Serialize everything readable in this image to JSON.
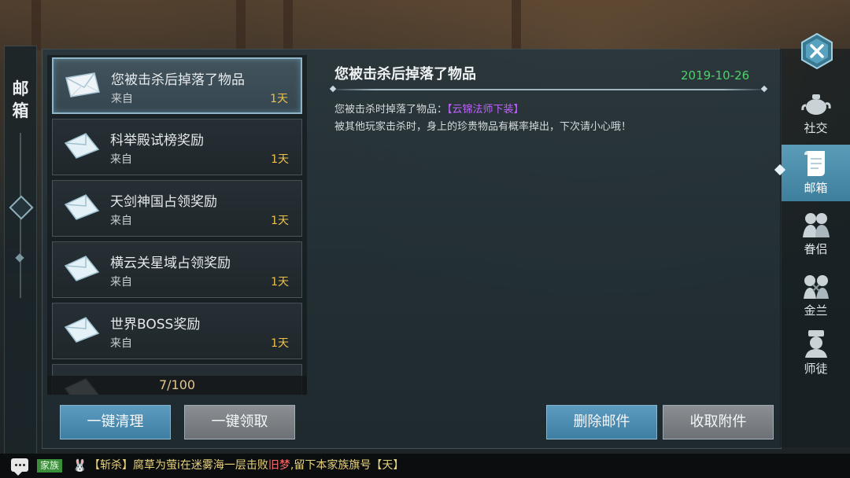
{
  "left_tab": {
    "title": "邮箱"
  },
  "mail_list": [
    {
      "subject": "您被击杀后掉落了物品",
      "from": "来自",
      "days": "1天",
      "selected": true
    },
    {
      "subject": "科举殿试榜奖励",
      "from": "来自",
      "days": "1天",
      "selected": false
    },
    {
      "subject": "天剑神国占领奖励",
      "from": "来自",
      "days": "1天",
      "selected": false
    },
    {
      "subject": "横云关星域占领奖励",
      "from": "来自",
      "days": "1天",
      "selected": false
    },
    {
      "subject": "世界BOSS奖励",
      "from": "来自",
      "days": "1天",
      "selected": false
    }
  ],
  "mail_count": "7/100",
  "detail": {
    "title": "您被击杀后掉落了物品",
    "date": "2019-10-26",
    "line1_prefix": "您被击杀时掉落了物品：",
    "line1_item": "【云锦法师下装】",
    "line2": "被其他玩家击杀时，身上的珍贵物品有概率掉出，下次请小心哦！"
  },
  "buttons": {
    "clear_all": "一键清理",
    "claim_all": "一键领取",
    "delete": "删除邮件",
    "collect": "收取附件"
  },
  "right_tabs": [
    {
      "label": "社交",
      "icon": "teapot-icon",
      "active": false
    },
    {
      "label": "邮箱",
      "icon": "mail-scroll-icon",
      "active": true
    },
    {
      "label": "眷侣",
      "icon": "couple-icon",
      "active": false
    },
    {
      "label": "金兰",
      "icon": "sworn-siblings-icon",
      "active": false
    },
    {
      "label": "师徒",
      "icon": "master-disciple-icon",
      "active": false
    }
  ],
  "chat": {
    "channel": "家族",
    "msg_a": "【斩杀】腐草为萤i在迷雾海一层击败",
    "msg_red": "旧梦",
    "msg_b": ",留下本家族旗号【天】"
  },
  "colors": {
    "accent_blue": "#4a8db3",
    "days_gold": "#f0c24a",
    "date_green": "#4fd06c",
    "item_purple": "#c060ff",
    "chat_red": "#ff6b6b"
  }
}
